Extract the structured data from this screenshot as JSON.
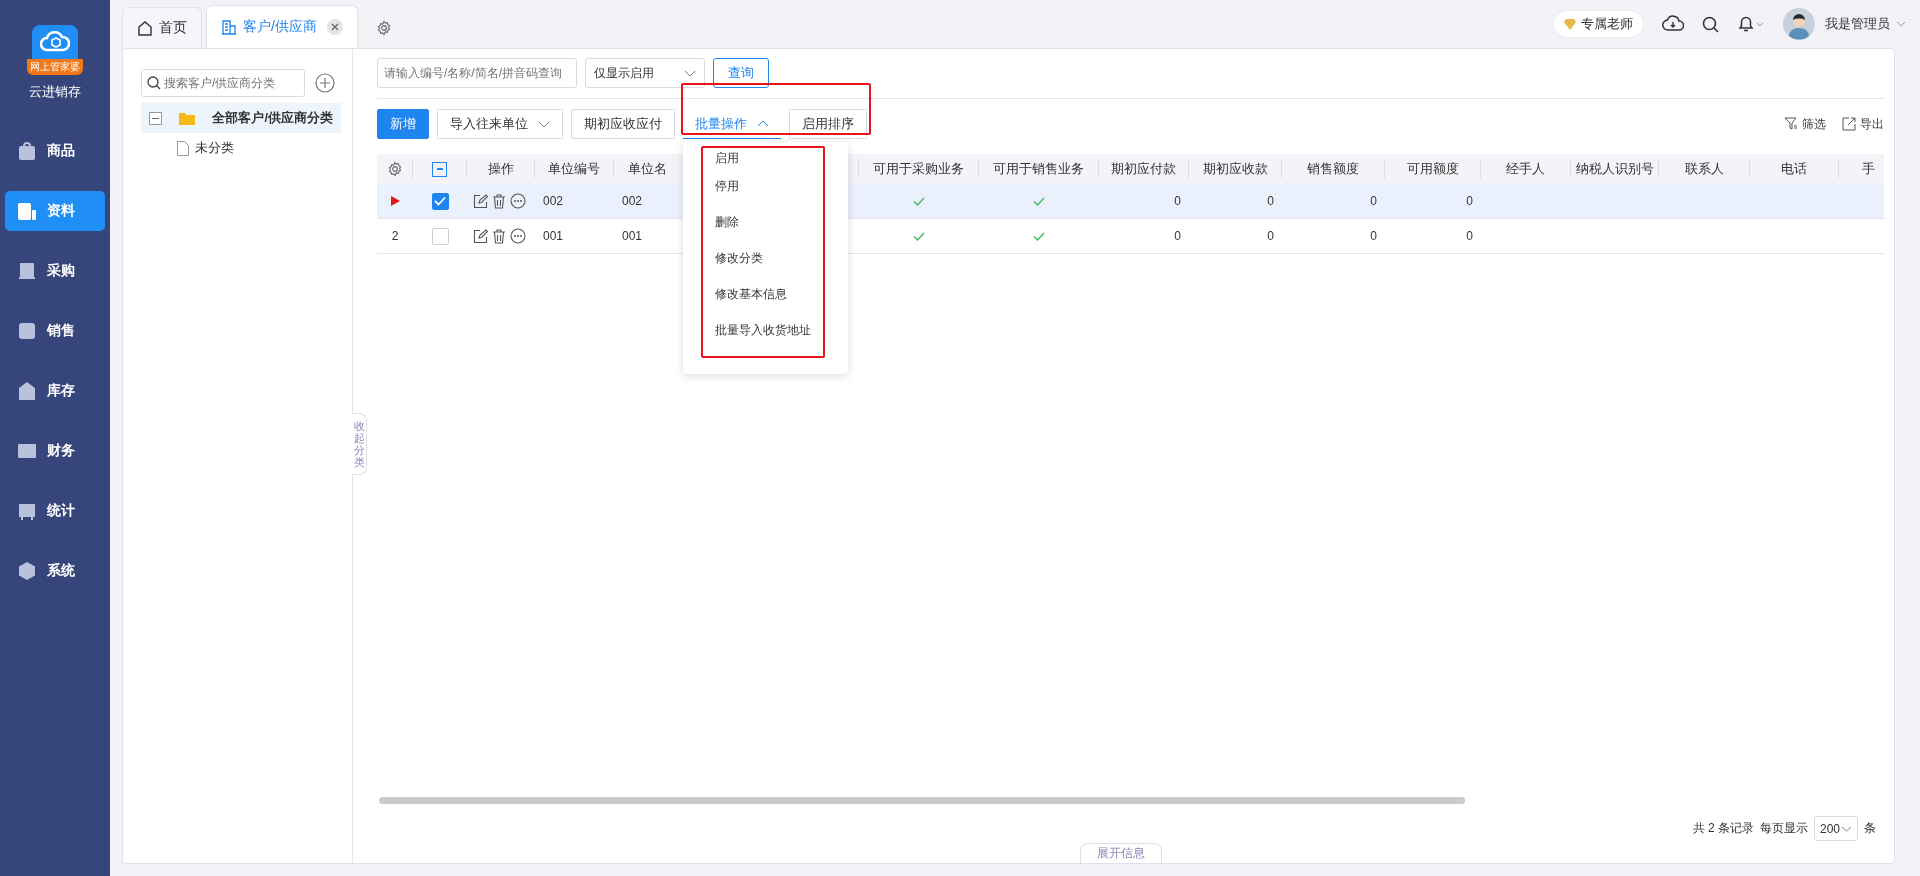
{
  "app": {
    "badge": "网上管家婆",
    "name": "云进销存"
  },
  "nav": [
    {
      "label": "商品",
      "selected": false
    },
    {
      "label": "资料",
      "selected": true
    },
    {
      "label": "采购",
      "selected": false
    },
    {
      "label": "销售",
      "selected": false
    },
    {
      "label": "库存",
      "selected": false
    },
    {
      "label": "财务",
      "selected": false
    },
    {
      "label": "统计",
      "selected": false
    },
    {
      "label": "系统",
      "selected": false
    }
  ],
  "tabs": [
    {
      "label": "首页",
      "selected": false,
      "closable": false
    },
    {
      "label": "客户/供应商",
      "selected": true,
      "closable": true
    }
  ],
  "header": {
    "teacher": "专属老师",
    "user": "我是管理员"
  },
  "tree": {
    "placeholder": "搜索客户/供应商分类",
    "items": [
      {
        "label": "全部客户/供应商分类",
        "expanded": true,
        "selected": true,
        "children": [
          {
            "label": "未分类",
            "selected": false
          }
        ]
      }
    ]
  },
  "collapse_tab": "收起分类",
  "filter": {
    "placeholder": "请输入编号/名称/简名/拼音码查询",
    "status": "仅显示启用",
    "query": "查询"
  },
  "toolbar": [
    {
      "label": "新增",
      "kind": "primary"
    },
    {
      "label": "导入往来单位",
      "kind": "dropdown",
      "expanded": false
    },
    {
      "label": "期初应收应付",
      "kind": "plain"
    },
    {
      "label": "批量操作",
      "kind": "dropdown",
      "expanded": true
    },
    {
      "label": "启用排序",
      "kind": "plain"
    }
  ],
  "menu": [
    "启用",
    "停用",
    "删除",
    "修改分类",
    "修改基本信息",
    "批量导入收货地址"
  ],
  "table_actions": [
    "筛选",
    "导出"
  ],
  "table": {
    "indeterminate": true,
    "columns": [
      "操作",
      "单位编号",
      "单位名",
      "可用于采购业务",
      "可用于销售业务",
      "期初应付款",
      "期初应收款",
      "销售额度",
      "可用额度",
      "经手人",
      "纳税人识别号",
      "联系人",
      "电话",
      "手"
    ],
    "rows": [
      {
        "current": true,
        "checked": true,
        "code": "002",
        "name": "002",
        "purchase": true,
        "sales": true,
        "payable": "0",
        "receivable": "0",
        "sales_limit": "0",
        "available": "0"
      },
      {
        "index": "2",
        "current": false,
        "checked": false,
        "code": "001",
        "name": "001",
        "purchase": true,
        "sales": true,
        "payable": "0",
        "receivable": "0",
        "sales_limit": "0",
        "available": "0"
      }
    ]
  },
  "pager": {
    "total": "共 2 条记录",
    "per_page_label": "每页显示",
    "per_page": "200",
    "unit": "条"
  },
  "expand_tab": "展开信息"
}
